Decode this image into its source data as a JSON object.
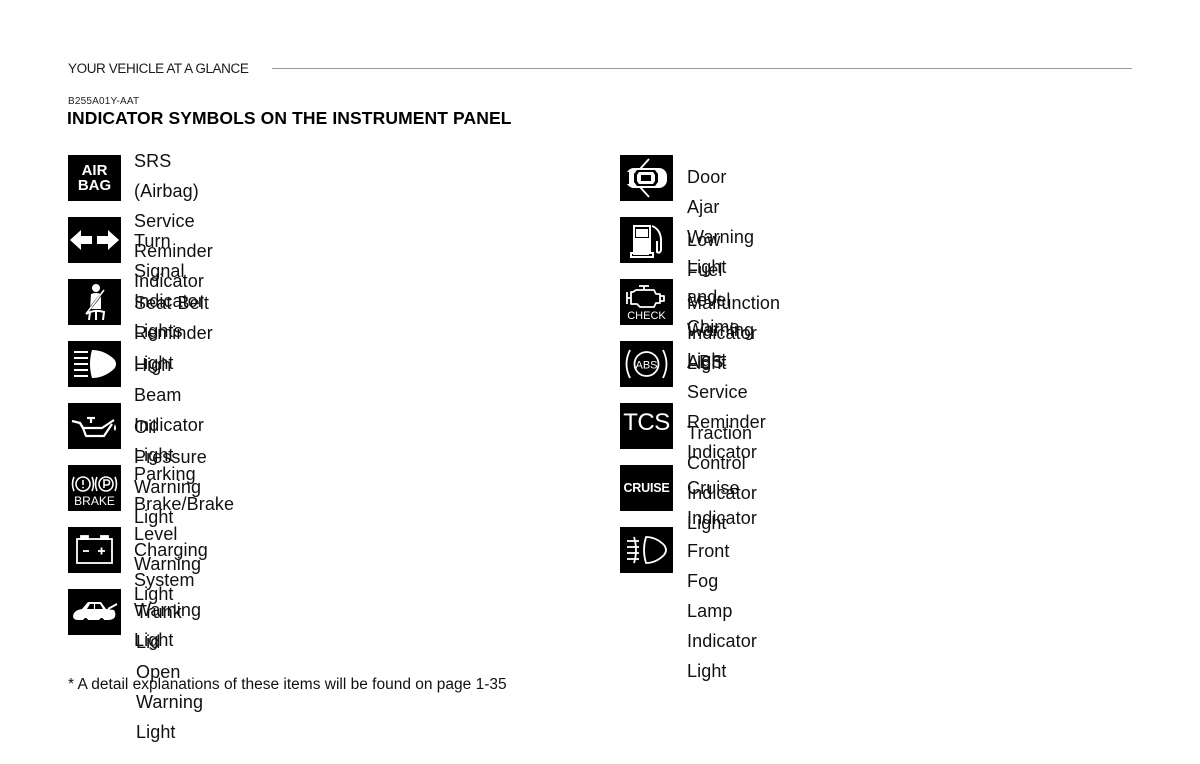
{
  "header": {
    "section": "YOUR VEHICLE AT A GLANCE",
    "code": "B255A01Y-AAT",
    "title": "INDICATOR SYMBOLS ON THE INSTRUMENT PANEL"
  },
  "left_items": [
    {
      "icon": "airbag-icon",
      "icon_text": [
        "AIR",
        "BAG"
      ],
      "label_lines": [
        "SRS (Airbag) Service Reminder",
        "Indicator"
      ]
    },
    {
      "icon": "turn-signal-arrows-icon",
      "label_lines": [
        "Turn Signal Indicator Lights"
      ]
    },
    {
      "icon": "seat-belt-icon",
      "label_lines": [
        "Seat Belt Reminder Light"
      ]
    },
    {
      "icon": "high-beam-icon",
      "label_lines": [
        "High Beam Indicator Light"
      ]
    },
    {
      "icon": "oil-can-icon",
      "label_lines": [
        "Oil Pressure Warning Light"
      ]
    },
    {
      "icon": "brake-icon",
      "icon_text": [
        "BRAKE"
      ],
      "label_lines": [
        "Parking Brake/Brake Level",
        "Warning Light"
      ]
    },
    {
      "icon": "battery-icon",
      "label_lines": [
        "Charging System Warning Light"
      ]
    },
    {
      "icon": "trunk-open-car-icon",
      "label_lines": [
        "Trunk Lid Open Warning Light"
      ]
    }
  ],
  "right_items": [
    {
      "icon": "door-ajar-car-icon",
      "label_lines": [
        "Door Ajar Warning Light and Chime"
      ]
    },
    {
      "icon": "fuel-pump-icon",
      "label_lines": [
        "Low Fuel Level Warning Light"
      ]
    },
    {
      "icon": "check-engine-icon",
      "icon_text": [
        "CHECK"
      ],
      "label_lines": [
        "Malfunction Indicator Light"
      ]
    },
    {
      "icon": "abs-icon",
      "icon_text": [
        "ABS"
      ],
      "label_lines": [
        "ABS Service Reminder Indicator"
      ]
    },
    {
      "icon": "tcs-icon",
      "icon_text": [
        "TCS"
      ],
      "label_lines": [
        "Traction Control Indicator Light"
      ]
    },
    {
      "icon": "cruise-icon",
      "icon_text": [
        "CRUISE"
      ],
      "label_lines": [
        "Cruise Indicator"
      ]
    },
    {
      "icon": "front-fog-lamp-icon",
      "label_lines": [
        "Front Fog Lamp Indicator Light"
      ]
    }
  ],
  "footnote": "* A detail explanations of these items will be found on page 1-35"
}
